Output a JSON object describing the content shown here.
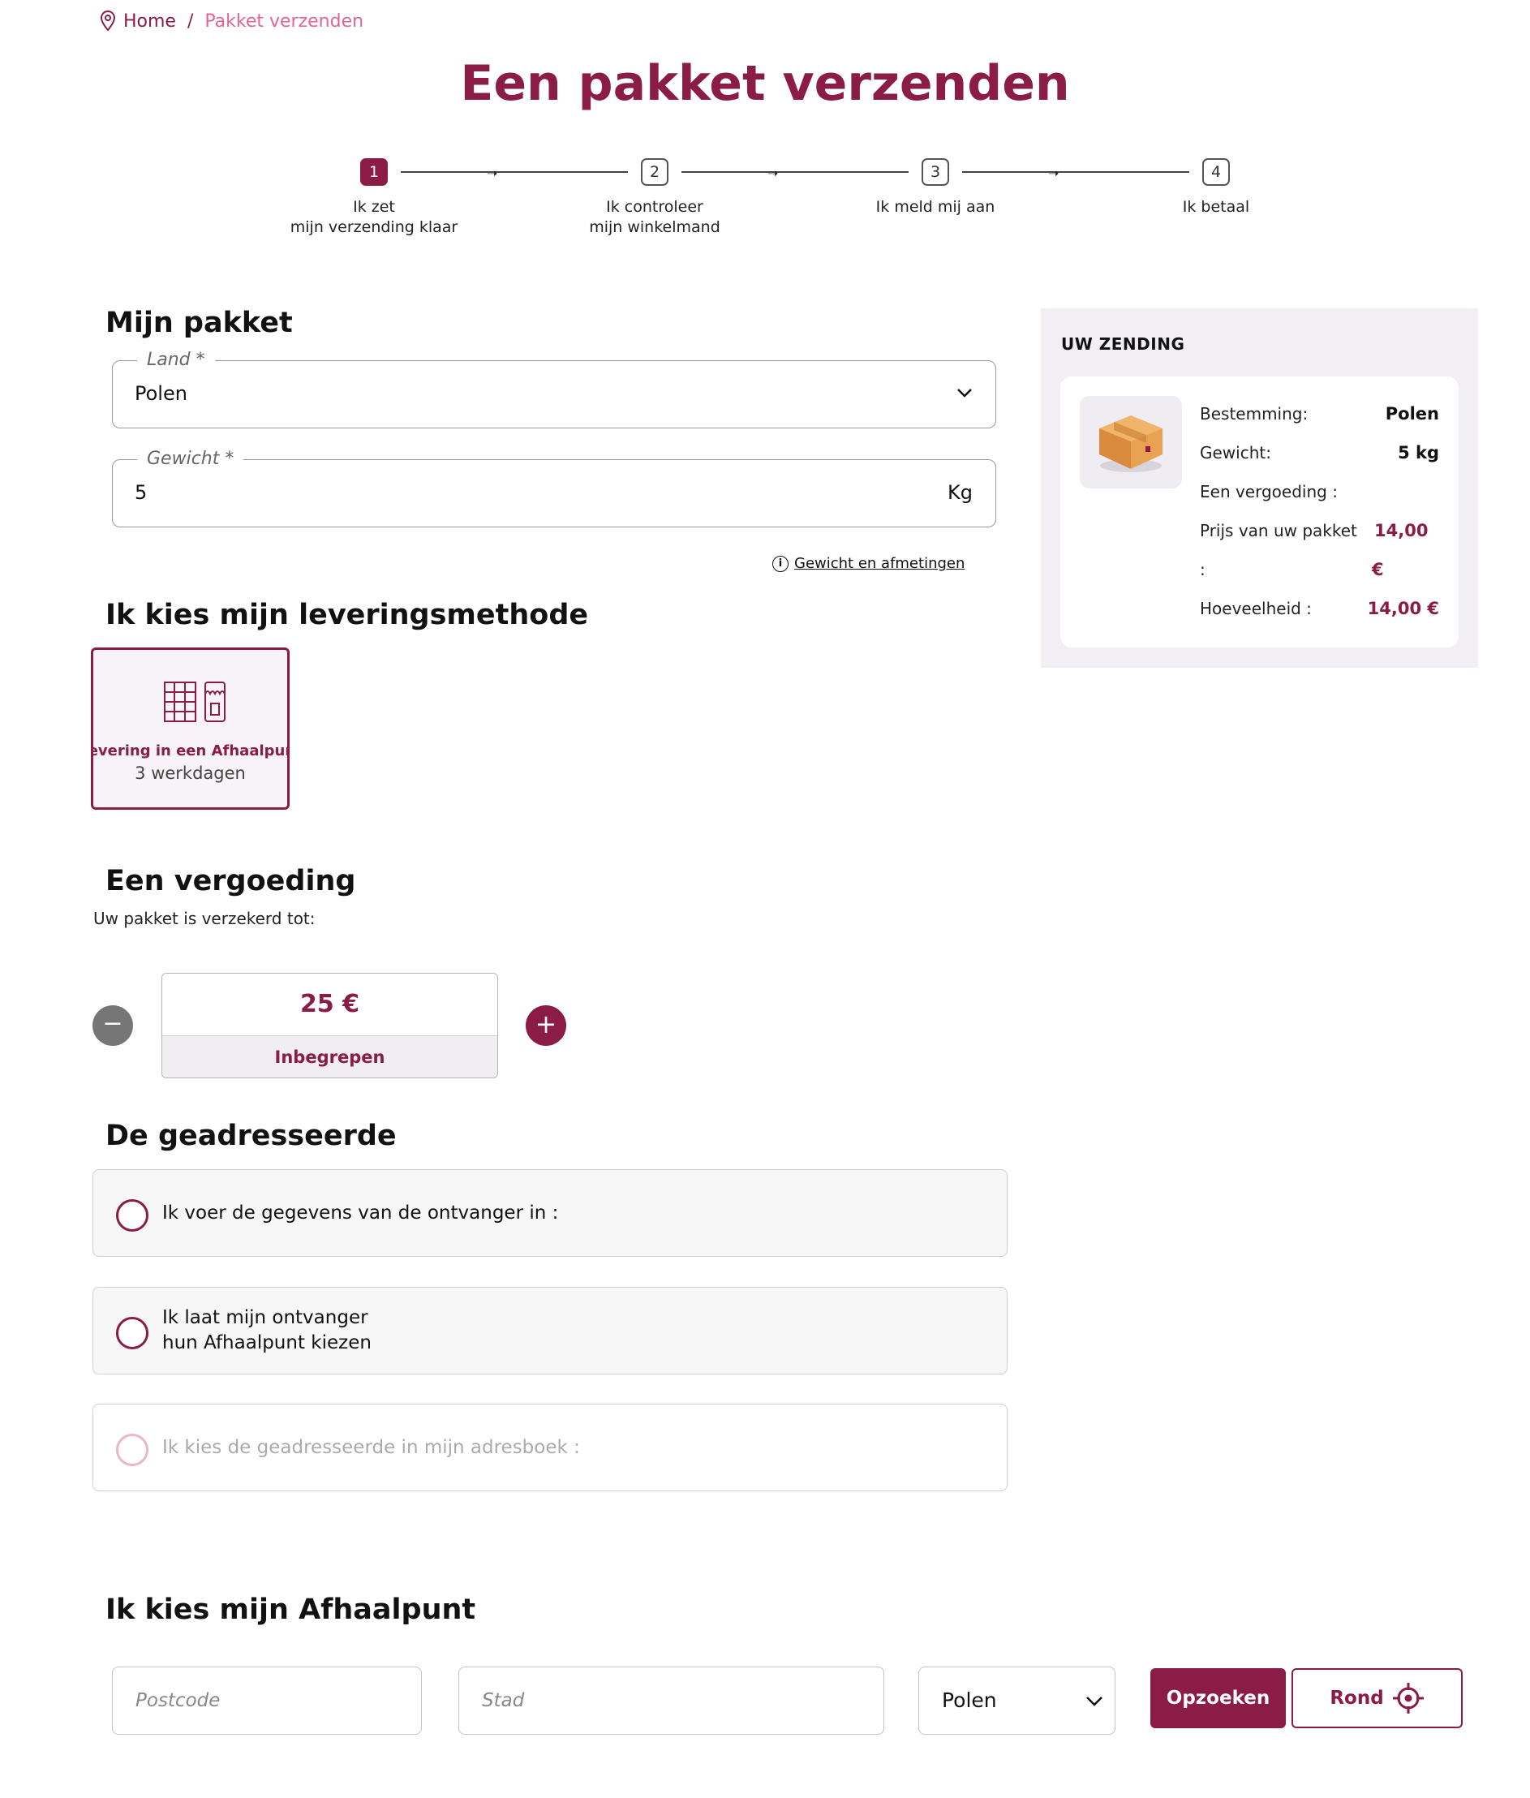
{
  "breadcrumb": {
    "home": "Home",
    "separator": "/",
    "current": "Pakket verzenden"
  },
  "page_title": "Een pakket verzenden",
  "steps": [
    {
      "num": "1",
      "label_line1": "Ik zet",
      "label_line2": "mijn verzending klaar"
    },
    {
      "num": "2",
      "label_line1": "Ik controleer",
      "label_line2": "mijn winkelmand"
    },
    {
      "num": "3",
      "label_line1": "Ik meld mij aan",
      "label_line2": ""
    },
    {
      "num": "4",
      "label_line1": "Ik betaal",
      "label_line2": ""
    }
  ],
  "package": {
    "heading": "Mijn pakket",
    "country_label": "Land *",
    "country_value": "Polen",
    "weight_label": "Gewicht *",
    "weight_value": "5",
    "weight_unit": "Kg",
    "weight_link": "Gewicht en afmetingen"
  },
  "delivery": {
    "heading": "Ik kies mijn leveringsmethode",
    "option_title": "Levering in een Afhaalpunt",
    "option_subtitle": "3 werkdagen"
  },
  "insurance": {
    "heading": "Een vergoeding",
    "subtitle": "Uw pakket is verzekerd tot:",
    "amount": "25 €",
    "included": "Inbegrepen",
    "minus": "−",
    "plus": "+"
  },
  "recipient": {
    "heading": "De geadresseerde",
    "option1": "Ik voer de gegevens van de ontvanger in :",
    "option2_line1": "Ik laat mijn ontvanger",
    "option2_line2": "hun Afhaalpunt kiezen",
    "option3": "Ik kies de geadresseerde in mijn adresboek :"
  },
  "pickup": {
    "heading": "Ik kies mijn Afhaalpunt",
    "postcode_placeholder": "Postcode",
    "city_placeholder": "Stad",
    "country_value": "Polen",
    "search_button": "Opzoeken",
    "around_button": "Rond"
  },
  "summary": {
    "title": "UW ZENDING",
    "destination_label": "Bestemming:",
    "destination_value": "Polen",
    "weight_label": "Gewicht:",
    "weight_value": "5 kg",
    "insurance_label": "Een vergoeding :",
    "price_label": "Prijs van uw pakket",
    "price_value_amount": "14,00",
    "price_colon": ":",
    "price_value_currency": "€",
    "quantity_label": "Hoeveelheid :",
    "quantity_value": "14,00 €"
  },
  "colors": {
    "brand": "#8a1c45",
    "brand_light": "#e0669a",
    "panel_bg": "#f2eff4"
  },
  "icons": [
    "location-pin-icon",
    "chevron-down-icon",
    "info-icon",
    "pickup-locker-icon",
    "shop-icon",
    "minus-icon",
    "plus-icon",
    "target-icon",
    "package-box-icon"
  ]
}
